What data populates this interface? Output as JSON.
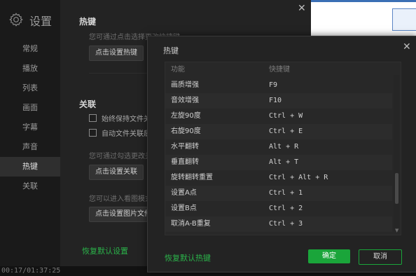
{
  "settings": {
    "title": "设置",
    "nav": [
      "常规",
      "播放",
      "列表",
      "画面",
      "字幕",
      "声音",
      "热键",
      "关联"
    ],
    "hotkey_section": {
      "title": "热键",
      "hint": "您可通过点击选择更改快捷键",
      "button": "点击设置热键"
    },
    "assoc_section": {
      "title": "关联",
      "check1": "始终保持文件关联",
      "check2": "自动文件关联后",
      "hint": "您可通过勾选更改关联",
      "button": "点击设置关联",
      "hint2": "您可以进入看图模式",
      "button2": "点击设置图片文件"
    },
    "reset_link": "恢复默认设置"
  },
  "dialog": {
    "title": "热键",
    "col_func": "功能",
    "col_key": "快捷键",
    "rows": [
      {
        "func": "画质增强",
        "key": "F9"
      },
      {
        "func": "音效增强",
        "key": "F10"
      },
      {
        "func": "左旋90度",
        "key": "Ctrl + W"
      },
      {
        "func": "右旋90度",
        "key": "Ctrl + E"
      },
      {
        "func": "水平翻转",
        "key": "Alt + R"
      },
      {
        "func": "垂直翻转",
        "key": "Alt + T"
      },
      {
        "func": "旋转翻转重置",
        "key": "Ctrl + Alt + R"
      },
      {
        "func": "设置A点",
        "key": "Ctrl + 1"
      },
      {
        "func": "设置B点",
        "key": "Ctrl + 2"
      },
      {
        "func": "取消A-B重复",
        "key": "Ctrl + 3"
      }
    ],
    "reset_link": "恢复默认热键",
    "ok": "确定",
    "cancel": "取消"
  },
  "status": {
    "time": "00:17/01:37:25"
  }
}
